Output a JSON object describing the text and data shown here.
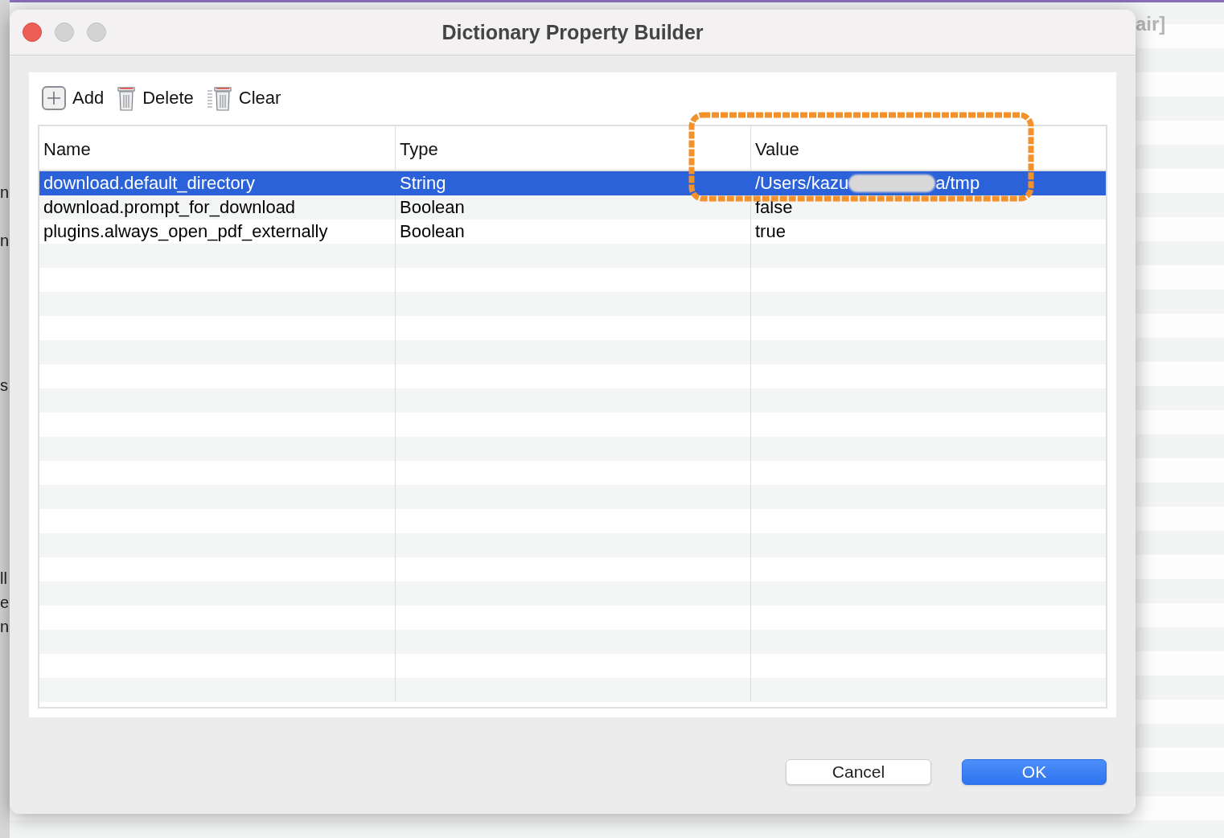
{
  "background_window": {
    "title_fragment": "air]",
    "side_fragments": [
      "n",
      "n",
      "s",
      "ll",
      "e",
      "n"
    ]
  },
  "window": {
    "title": "Dictionary Property Builder"
  },
  "toolbar": [
    {
      "kind": "add",
      "label": "Add"
    },
    {
      "kind": "delete",
      "label": "Delete"
    },
    {
      "kind": "clear",
      "label": "Clear"
    }
  ],
  "table": {
    "columns": [
      "Name",
      "Type",
      "Value"
    ],
    "rows": [
      {
        "name": "download.default_directory",
        "type": "String",
        "value_start": "/Users/kazu",
        "value_end": "a/tmp",
        "redacted": true,
        "selected": true
      },
      {
        "name": "download.prompt_for_download",
        "type": "Boolean",
        "value_start": "false",
        "redacted": false,
        "selected": false
      },
      {
        "name": "plugins.always_open_pdf_externally",
        "type": "Boolean",
        "value_start": "true",
        "redacted": false,
        "selected": false
      }
    ]
  },
  "annotation": {
    "kind": "highlight-ring"
  },
  "buttons": [
    {
      "label": "Cancel",
      "default": false
    },
    {
      "label": "OK",
      "default": true
    }
  ]
}
